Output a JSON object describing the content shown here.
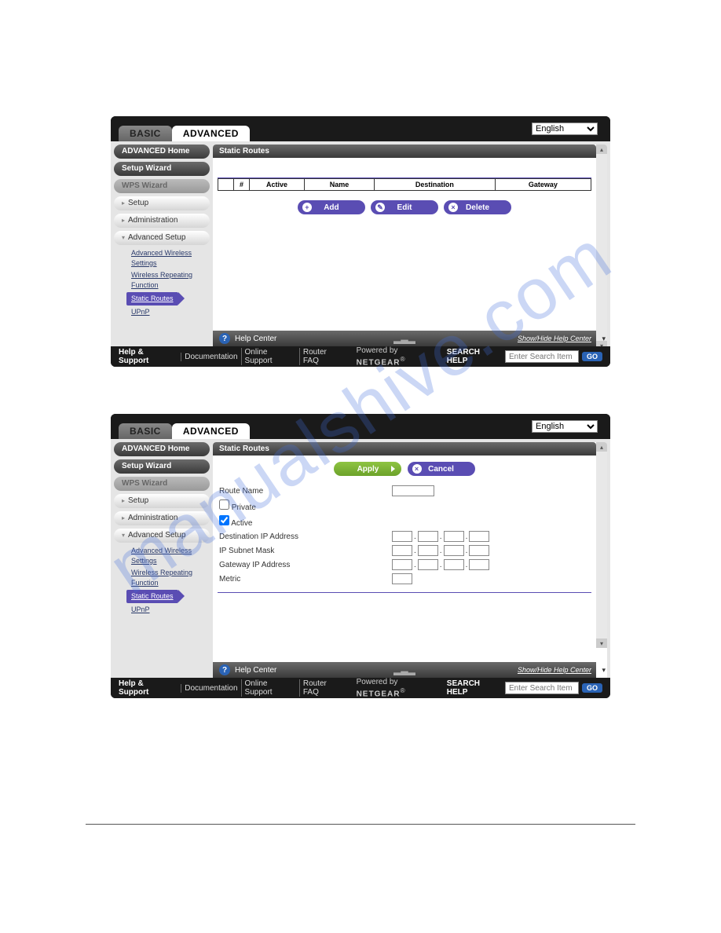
{
  "watermark": "manualshive.com",
  "tabs": {
    "basic": "BASIC",
    "advanced": "ADVANCED"
  },
  "language": {
    "selected": "English"
  },
  "sidebar": {
    "adv_home": "ADVANCED Home",
    "setup_wizard": "Setup Wizard",
    "wps_wizard": "WPS Wizard",
    "items": [
      "Setup",
      "Administration",
      "Advanced Setup"
    ],
    "sub": {
      "adv_wireless": "Advanced Wireless Settings",
      "wireless_repeat": "Wireless Repeating Function",
      "static_routes": "Static Routes",
      "upnp": "UPnP"
    }
  },
  "panel1": {
    "title": "Static Routes",
    "headers": {
      "num": "#",
      "active": "Active",
      "name": "Name",
      "destination": "Destination",
      "gateway": "Gateway"
    },
    "buttons": {
      "add": "Add",
      "edit": "Edit",
      "delete": "Delete"
    }
  },
  "panel2": {
    "title": "Static Routes",
    "buttons": {
      "apply": "Apply",
      "cancel": "Cancel"
    },
    "fields": {
      "route_name": "Route Name",
      "private": "Private",
      "active": "Active",
      "dest_ip": "Destination IP Address",
      "subnet": "IP Subnet Mask",
      "gateway_ip": "Gateway IP Address",
      "metric": "Metric"
    }
  },
  "helpbar": {
    "label": "Help Center",
    "showhide": "Show/Hide Help Center"
  },
  "footer": {
    "help_support": "Help & Support",
    "links": [
      "Documentation",
      "Online Support",
      "Router FAQ"
    ],
    "powered": "Powered by",
    "brand": "NETGEAR",
    "search_label": "SEARCH HELP",
    "search_placeholder": "Enter Search Item",
    "go": "GO"
  }
}
